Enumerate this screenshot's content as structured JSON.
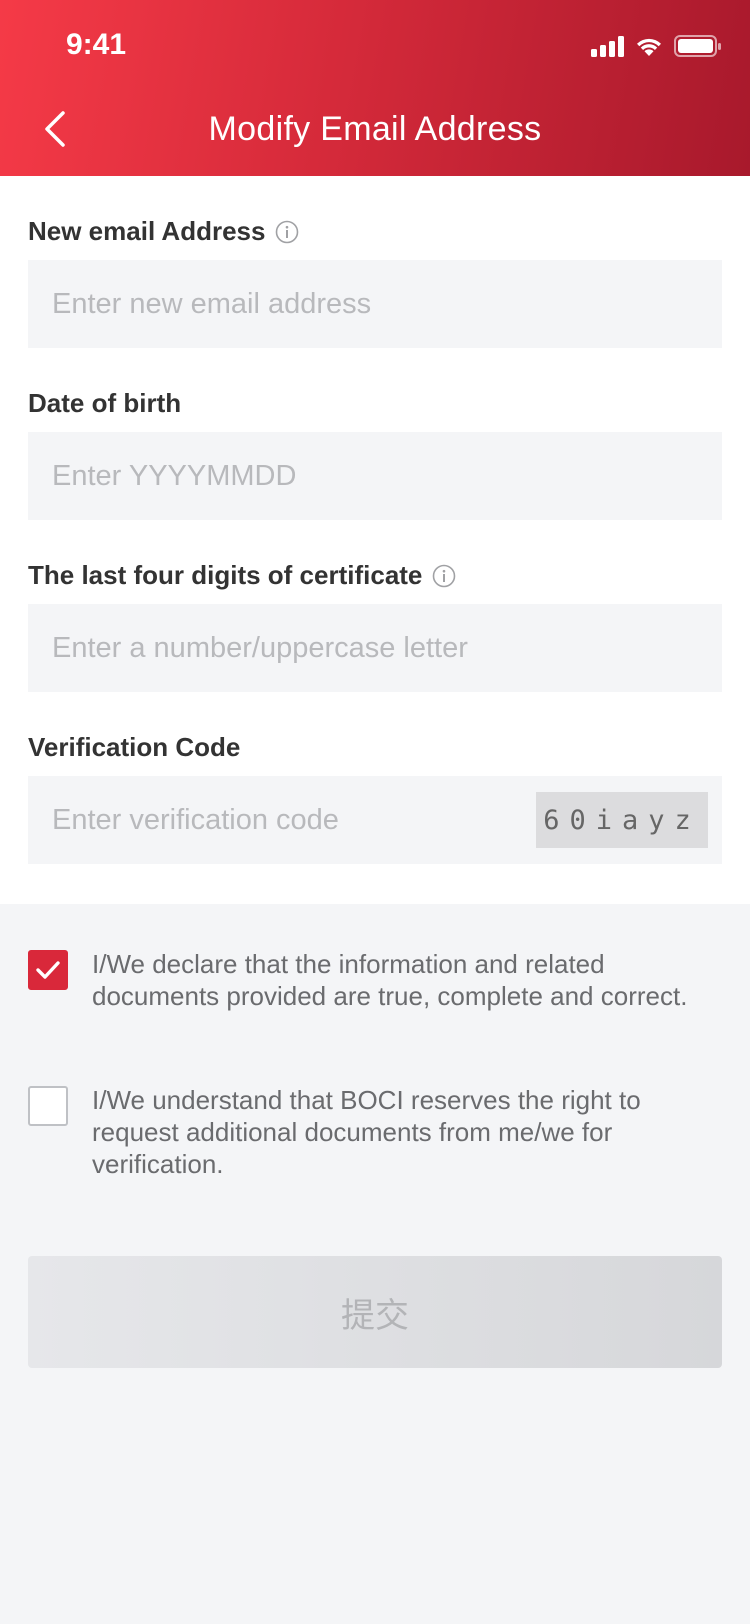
{
  "status_bar": {
    "time": "9:41"
  },
  "header": {
    "title": "Modify Email Address"
  },
  "fields": {
    "email": {
      "label": "New email Address",
      "placeholder": "Enter new email address",
      "value": ""
    },
    "dob": {
      "label": "Date of birth",
      "placeholder": "Enter YYYYMMDD",
      "value": ""
    },
    "certificate": {
      "label": "The last four digits of certificate",
      "placeholder": "Enter a number/uppercase letter",
      "value": ""
    },
    "verification": {
      "label": "Verification Code",
      "placeholder": "Enter verification code",
      "value": "",
      "captcha": "60iayz"
    }
  },
  "declarations": [
    {
      "text": "I/We declare that the information and related documents provided are true, complete and correct.",
      "checked": true
    },
    {
      "text": "I/We understand that BOCI reserves the right to request additional documents from me/we for verification.",
      "checked": false
    }
  ],
  "submit_label": "提交",
  "colors": {
    "accent": "#d9283a",
    "header_start": "#f53a47",
    "header_end": "#a8192c"
  }
}
